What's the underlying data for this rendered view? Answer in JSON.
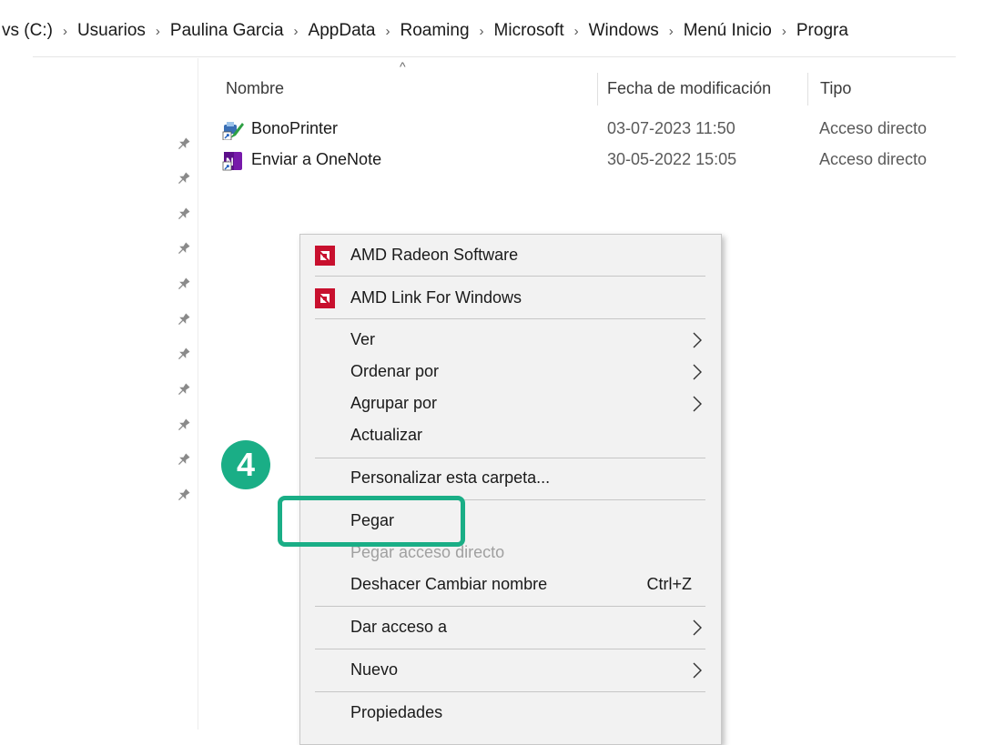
{
  "breadcrumb": {
    "items": [
      "vs (C:)",
      "Usuarios",
      "Paulina Garcia",
      "AppData",
      "Roaming",
      "Microsoft",
      "Windows",
      "Menú Inicio",
      "Progra"
    ],
    "separator": "›"
  },
  "columns": {
    "name": "Nombre",
    "date": "Fecha de modificación",
    "type": "Tipo"
  },
  "files": [
    {
      "name": "BonoPrinter",
      "date": "03-07-2023 11:50",
      "type": "Acceso directo",
      "icon": "shortcut-printer-icon"
    },
    {
      "name": "Enviar a OneNote",
      "date": "30-05-2022 15:05",
      "type": "Acceso directo",
      "icon": "onenote-icon"
    }
  ],
  "context_menu": {
    "amd_radeon": "AMD Radeon Software",
    "amd_link": "AMD Link For Windows",
    "ver": "Ver",
    "ordenar": "Ordenar por",
    "agrupar": "Agrupar por",
    "actualizar": "Actualizar",
    "personalizar": "Personalizar esta carpeta...",
    "pegar": "Pegar",
    "pegar_acceso": "Pegar acceso directo",
    "deshacer": "Deshacer Cambiar nombre",
    "deshacer_shortcut": "Ctrl+Z",
    "dar_acceso": "Dar acceso a",
    "nuevo": "Nuevo",
    "propiedades": "Propiedades"
  },
  "annotation": {
    "step": "4",
    "color": "#1aae86"
  },
  "colors": {
    "amd_red": "#c8102e",
    "accent_green": "#1aae86"
  }
}
